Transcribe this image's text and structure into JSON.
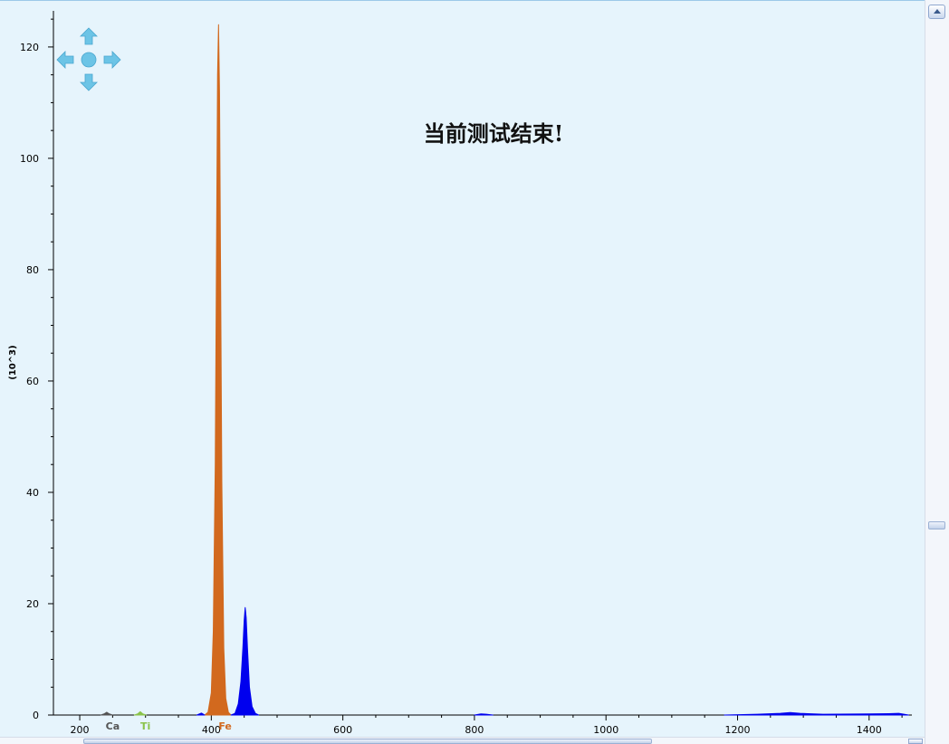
{
  "status_message": "当前测试结束!",
  "nav_control": {
    "icons": [
      "arrow-up-icon",
      "arrow-down-icon",
      "arrow-left-icon",
      "arrow-right-icon",
      "center-dot-icon"
    ],
    "color": "#6cc4e6"
  },
  "chart_data": {
    "type": "area",
    "xlim": [
      160,
      1465
    ],
    "ylim": [
      0,
      126
    ],
    "xticks": [
      200,
      400,
      600,
      800,
      1000,
      1200,
      1400
    ],
    "yticks": [
      0,
      20,
      40,
      60,
      80,
      100,
      120
    ],
    "ylabel": "(10^3)",
    "xlabel": "",
    "grid": false,
    "series": [
      {
        "name": "Fe",
        "color": "#d2691e",
        "x": [
          390,
          395,
          400,
          403,
          406,
          408,
          409.5,
          411,
          412.5,
          414,
          416,
          419,
          422,
          426,
          430
        ],
        "values": [
          0,
          0.5,
          4,
          15,
          45,
          85,
          115,
          124,
          112,
          82,
          42,
          12,
          3,
          0.5,
          0
        ]
      },
      {
        "name": "",
        "color": "#0000ee",
        "x": [
          430,
          436,
          441,
          445,
          448,
          450,
          451.5,
          453,
          455,
          458,
          462,
          467,
          472
        ],
        "values": [
          0,
          0.3,
          2,
          6,
          12,
          17,
          19.3,
          17.5,
          12,
          5,
          1.5,
          0.3,
          0
        ]
      },
      {
        "name": "Ca",
        "color": "#555555",
        "x": [
          232,
          237,
          241,
          245,
          250
        ],
        "values": [
          0,
          0.2,
          0.5,
          0.2,
          0
        ]
      },
      {
        "name": "Ti",
        "color": "#8bc34a",
        "x": [
          283,
          288,
          292,
          296,
          301
        ],
        "values": [
          0,
          0.2,
          0.6,
          0.2,
          0
        ]
      },
      {
        "name": "",
        "color": "#0000ee",
        "x": [
          378,
          385,
          390
        ],
        "values": [
          0,
          0.35,
          0
        ]
      },
      {
        "name": "",
        "color": "#0000ee",
        "x": [
          800,
          810,
          818,
          828
        ],
        "values": [
          0,
          0.2,
          0.15,
          0
        ]
      },
      {
        "name": "",
        "color": "#0000ee",
        "x": [
          1180,
          1230,
          1265,
          1280,
          1295,
          1330,
          1400,
          1430,
          1445,
          1460
        ],
        "values": [
          0,
          0.15,
          0.3,
          0.45,
          0.3,
          0.15,
          0.2,
          0.25,
          0.3,
          0
        ]
      }
    ],
    "element_labels": [
      {
        "text": "Ca",
        "x": 250,
        "color": "#555555"
      },
      {
        "text": "Ti",
        "x": 300,
        "color": "#8bc34a"
      },
      {
        "text": "Fe",
        "x": 421,
        "color": "#d2691e"
      }
    ]
  }
}
